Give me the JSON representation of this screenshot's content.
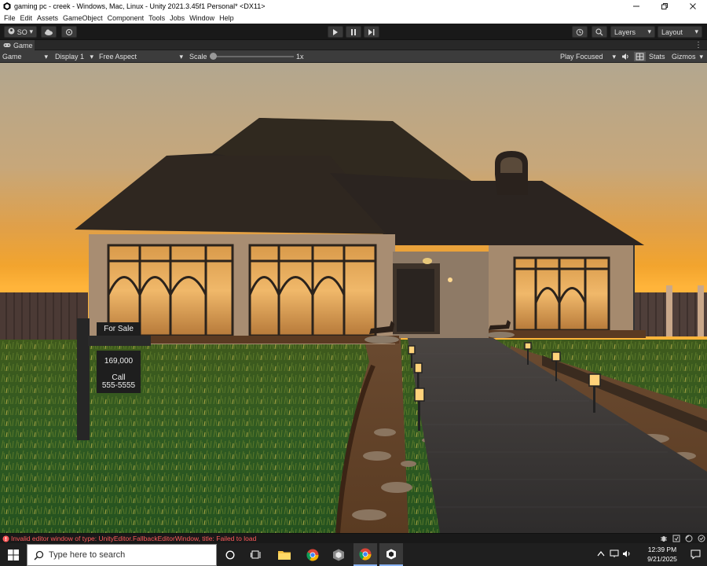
{
  "window": {
    "title": "gaming pc - creek - Windows, Mac, Linux - Unity 2021.3.45f1 Personal* <DX11>",
    "minimize_icon": "minimize-icon",
    "restore_icon": "restore-icon",
    "close_icon": "close-icon"
  },
  "menu": [
    "File",
    "Edit",
    "Assets",
    "GameObject",
    "Component",
    "Tools",
    "Jobs",
    "Window",
    "Help"
  ],
  "toolbar": {
    "account": "SO",
    "layers": "Layers",
    "layout": "Layout"
  },
  "tab": {
    "label": "Game"
  },
  "game_toolbar": {
    "mode": "Game",
    "display": "Display 1",
    "aspect": "Free Aspect",
    "scale_label": "Scale",
    "scale_value": "1x",
    "play_focused": "Play Focused",
    "stats": "Stats",
    "gizmos": "Gizmos"
  },
  "scene": {
    "sign_title": "For Sale",
    "sign_price": "169,000",
    "sign_call": "Call",
    "sign_phone": "555-5555"
  },
  "console": {
    "error": "Invalid editor window of type: UnityEditor.FallbackEditorWindow, title: Failed to load"
  },
  "taskbar": {
    "search_placeholder": "Type here to search",
    "time": "12:39 PM",
    "date": "9/21/2025"
  },
  "colors": {
    "editor_bg": "#191919",
    "error_text": "#ff5b5b",
    "sky_top": "#b8aa8f",
    "sky_horizon": "#f2a42e"
  }
}
